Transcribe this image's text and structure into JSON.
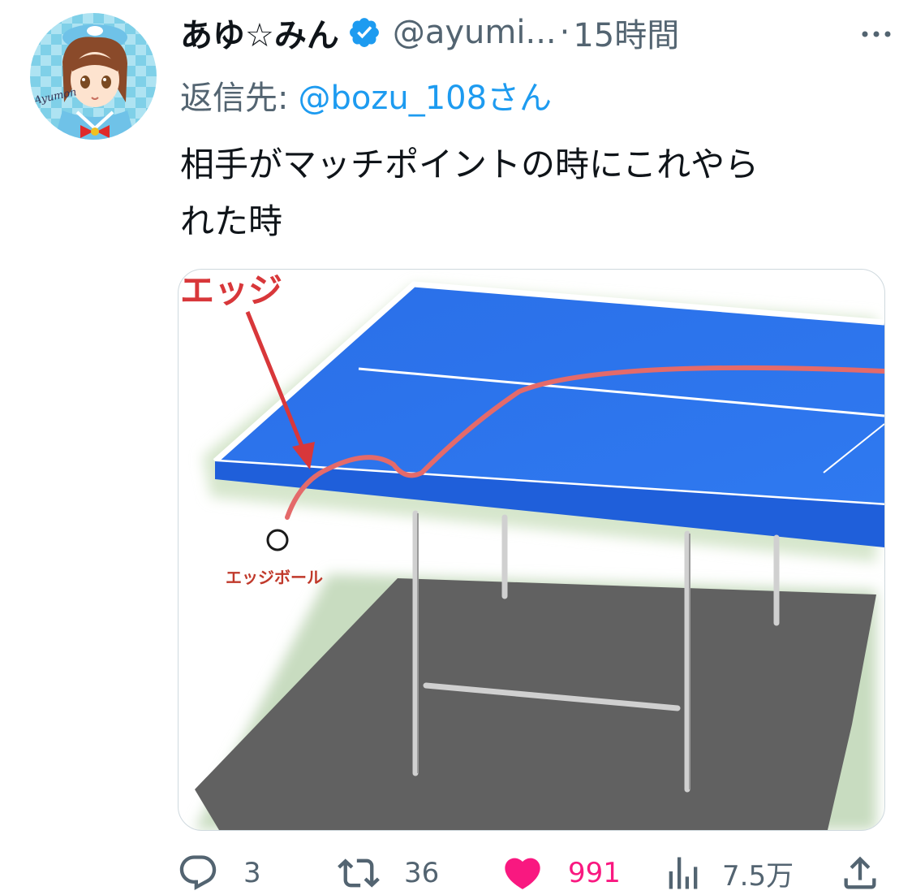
{
  "tweet": {
    "display_name": "あゆ☆みん",
    "handle": "@ayumi...",
    "separator": "·",
    "time_ago": "15時間",
    "reply_prefix": "返信先:",
    "reply_to": "@bozu_108さん",
    "text_line1": "相手がマッチポイントの時にこれやら",
    "text_line2": "れた時",
    "avatar_label": "Ayumon"
  },
  "media": {
    "label_edge": "エッジ",
    "label_edge_ball": "エッジボール"
  },
  "actions": {
    "reply_count": "3",
    "retweet_count": "36",
    "like_count": "991",
    "views_count": "7.5万"
  },
  "colors": {
    "verified": "#1d9bf0",
    "link": "#1d9bf0",
    "like": "#f91880",
    "secondary_text": "#536471",
    "table_blue": "#2f6fe0",
    "arrow_red": "#d8373a"
  },
  "icons": [
    "verified-badge-icon",
    "more-icon",
    "reply-icon",
    "retweet-icon",
    "like-icon",
    "views-icon",
    "share-icon"
  ]
}
